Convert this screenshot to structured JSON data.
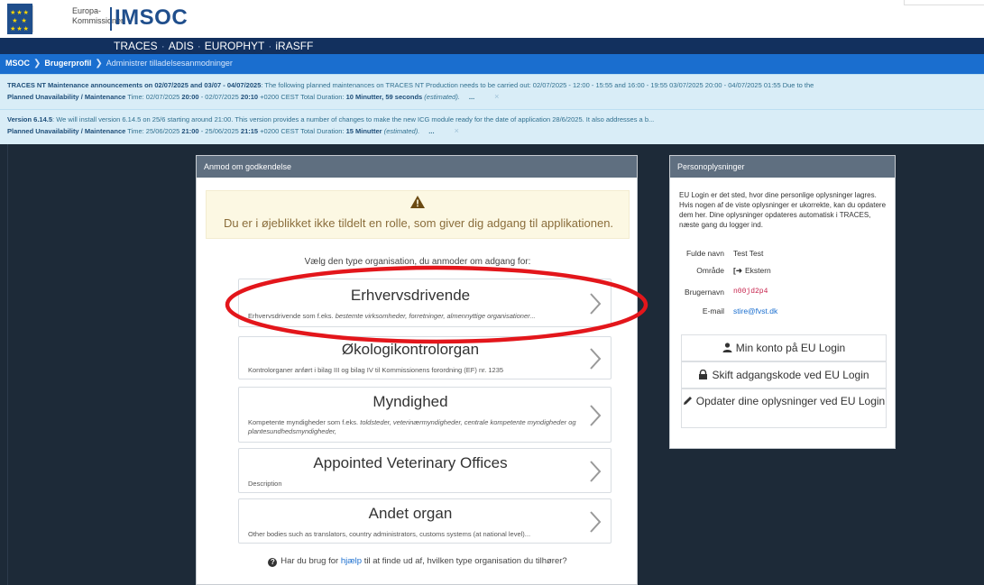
{
  "header": {
    "ec_line1": "Europa-",
    "ec_line2": "Kommissionen",
    "brand": "IMSOC"
  },
  "nav": {
    "items": [
      "TRACES",
      "ADIS",
      "EUROPHYT",
      "iRASFF"
    ]
  },
  "breadcrumb": {
    "root": "MSOC",
    "profile": "Brugerprofil",
    "current": "Administrer tilladelsesanmodninger"
  },
  "alerts": [
    {
      "title": "TRACES NT Maintenance announcements on 02/07/2025 and 03/07 - 04/07/2025",
      "body": ": The following planned maintenances on TRACES NT Production needs to be carried out: 02/07/2025 - 12:00 - 15:55 and 16:00 - 19:55  03/07/2025 20:00 - 04/07/2025 01:55  Due to the",
      "pu_label": "Planned Unavailability / Maintenance",
      "pu_time_prefix": " Time: 02/07/2025 ",
      "pu_start": "20:00",
      "pu_mid": " - 02/07/2025 ",
      "pu_end": "20:10",
      "pu_tz": " +0200 CEST Total Duration: ",
      "pu_duration": "10 Minutter, 59 seconds",
      "pu_est": " (estimated).",
      "more": "...",
      "close": "×"
    },
    {
      "title": "Version 6.14.5",
      "body": ": We will install version 6.14.5 on 25/6 starting around 21:00. This version provides a number of changes to make the new ICG module ready for the date of application 28/6/2025. It also addresses a b...",
      "pu_label": "Planned Unavailability / Maintenance",
      "pu_time_prefix": " Time: 25/06/2025 ",
      "pu_start": "21:00",
      "pu_mid": " - 25/06/2025 ",
      "pu_end": "21:15",
      "pu_tz": " +0200 CEST Total Duration: ",
      "pu_duration": "15 Minutter",
      "pu_est": " (estimated).",
      "more": "...",
      "close": "×"
    }
  ],
  "request_panel": {
    "title": "Anmod om godkendelse",
    "warning": "Du er i øjeblikket ikke tildelt en rolle, som giver dig adgang til applikationen.",
    "choose": "Vælg den type organisation, du anmoder om adgang for:",
    "orgs": [
      {
        "title": "Erhvervsdrivende",
        "desc_plain": "Erhvervsdrivende som f.eks. ",
        "desc_italic": "bestemte virksomheder, forretninger, almennyttige organisationer..."
      },
      {
        "title": "Økologikontrolorgan",
        "desc_plain": "Kontrolorganer anført i bilag III og bilag IV til Kommissionens forordning (EF) nr. 1235",
        "desc_italic": ""
      },
      {
        "title": "Myndighed",
        "desc_plain": "Kompetente myndigheder som f.eks. ",
        "desc_italic": "toldsteder, veterinærmyndigheder, centrale kompetente myndigheder og plantesundhedsmyndigheder,"
      },
      {
        "title": "Appointed Veterinary Offices",
        "desc_plain": "Description",
        "desc_italic": ""
      },
      {
        "title": "Andet organ",
        "desc_plain": "Other bodies such as translators, country administrators, customs systems (at national level)...",
        "desc_italic": ""
      }
    ],
    "help_prefix": "Har du brug for ",
    "help_link": "hjælp",
    "help_suffix": " til at finde ud af, hvilken type organisation du tilhører?"
  },
  "info_panel": {
    "title": "Personoplysninger",
    "text": "EU Login er det sted, hvor dine personlige oplysninger lagres. Hvis nogen af de viste oplysninger er ukorrekte, kan du opdatere dem her. Dine oplysninger opdateres automatisk i TRACES, næste gang du logger ind.",
    "rows": [
      {
        "label": "Fulde navn",
        "value": "Test Test"
      },
      {
        "label": "Område",
        "value": "Ekstern"
      },
      {
        "label": "Brugernavn",
        "value": "n00jd2p4"
      },
      {
        "label": "E-mail",
        "value": "stire@fvst.dk"
      }
    ],
    "buttons": [
      {
        "label": "Min konto på EU Login",
        "icon": "user-icon"
      },
      {
        "label": "Skift adgangskode ved EU Login",
        "icon": "lock-icon"
      },
      {
        "label": "Opdater dine oplysninger ved EU Login",
        "icon": "pencil-icon"
      }
    ]
  },
  "colors": {
    "navbar": "#12305e",
    "breadcrumb_bar": "#1a6ecf",
    "alert_bg": "#d9edf7",
    "page_bg": "#1d2a38",
    "panel_header": "#5f6f80",
    "warning_bg": "#fcf8e3",
    "annotation": "#e3161b"
  }
}
